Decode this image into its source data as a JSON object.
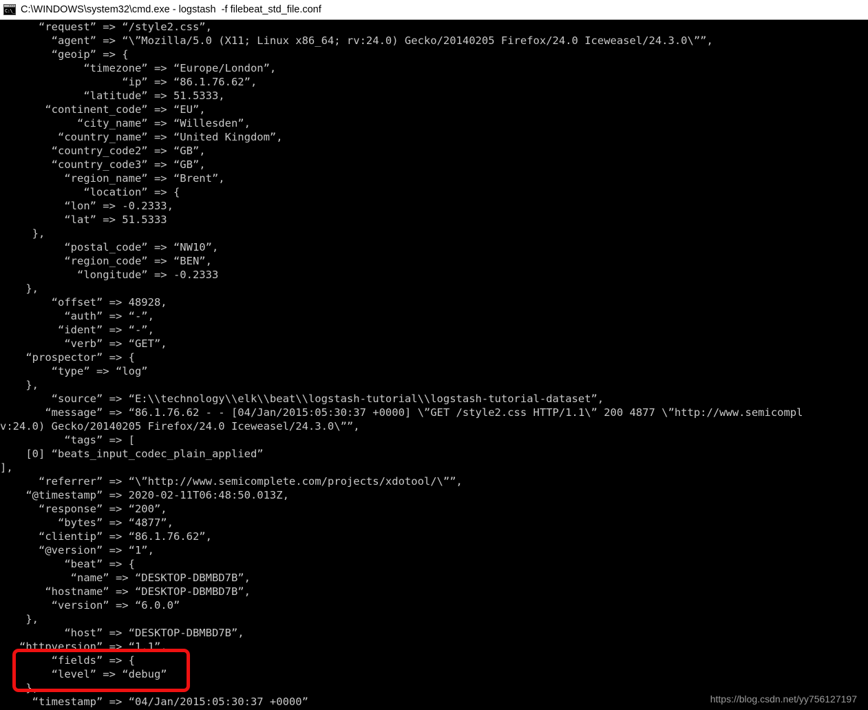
{
  "window": {
    "title": "C:\\WINDOWS\\system32\\cmd.exe - logstash  -f filebeat_std_file.conf",
    "icon": "cmd-console-icon",
    "icon_text": "C:\\_",
    "background_color": "#000000",
    "titlebar_color": "#ffffff",
    "text_color": "#c8c8c8"
  },
  "console": {
    "lines": [
      "      “request” => “/style2.css”,",
      "        “agent” => “\\”Mozilla/5.0 (X11; Linux x86_64; rv:24.0) Gecko/20140205 Firefox/24.0 Iceweasel/24.3.0\\””,",
      "        “geoip” => {",
      "             “timezone” => “Europe/London”,",
      "                   “ip” => “86.1.76.62”,",
      "             “latitude” => 51.5333,",
      "       “continent_code” => “EU”,",
      "            “city_name” => “Willesden”,",
      "         “country_name” => “United Kingdom”,",
      "        “country_code2” => “GB”,",
      "        “country_code3” => “GB”,",
      "          “region_name” => “Brent”,",
      "             “location” => {",
      "          “lon” => -0.2333,",
      "          “lat” => 51.5333",
      "     },",
      "          “postal_code” => “NW10”,",
      "          “region_code” => “BEN”,",
      "            “longitude” => -0.2333",
      "    },",
      "        “offset” => 48928,",
      "          “auth” => “-”,",
      "         “ident” => “-”,",
      "          “verb” => “GET”,",
      "    “prospector” => {",
      "        “type” => “log”",
      "    },",
      "        “source” => “E:\\\\technology\\\\elk\\\\beat\\\\logstash-tutorial\\\\logstash-tutorial-dataset”,",
      "       “message” => “86.1.76.62 - - [04/Jan/2015:05:30:37 +0000] \\”GET /style2.css HTTP/1.1\\” 200 4877 \\”http://www.semicompl",
      "v:24.0) Gecko/20140205 Firefox/24.0 Iceweasel/24.3.0\\””,",
      "          “tags” => [",
      "    [0] “beats_input_codec_plain_applied”",
      "],",
      "      “referrer” => “\\”http://www.semicomplete.com/projects/xdotool/\\””,",
      "    “@timestamp” => 2020-02-11T06:48:50.013Z,",
      "      “response” => “200”,",
      "         “bytes” => “4877”,",
      "      “clientip” => “86.1.76.62”,",
      "      “@version” => “1”,",
      "          “beat” => {",
      "           “name” => “DESKTOP-DBMBD7B”,",
      "       “hostname” => “DESKTOP-DBMBD7B”,",
      "        “version” => “6.0.0”",
      "    },",
      "          “host” => “DESKTOP-DBMBD7B”,",
      "   “httpversion” => “1.1”,",
      "        “fields” => {",
      "        “level” => “debug”",
      "    },",
      "     “timestamp” => “04/Jan/2015:05:30:37 +0000”"
    ]
  },
  "annotation": {
    "highlight_color": "#ee1111",
    "highlight_label": "fields-level-debug-highlight"
  },
  "watermark": {
    "text": "https://blog.csdn.net/yy756127197"
  }
}
